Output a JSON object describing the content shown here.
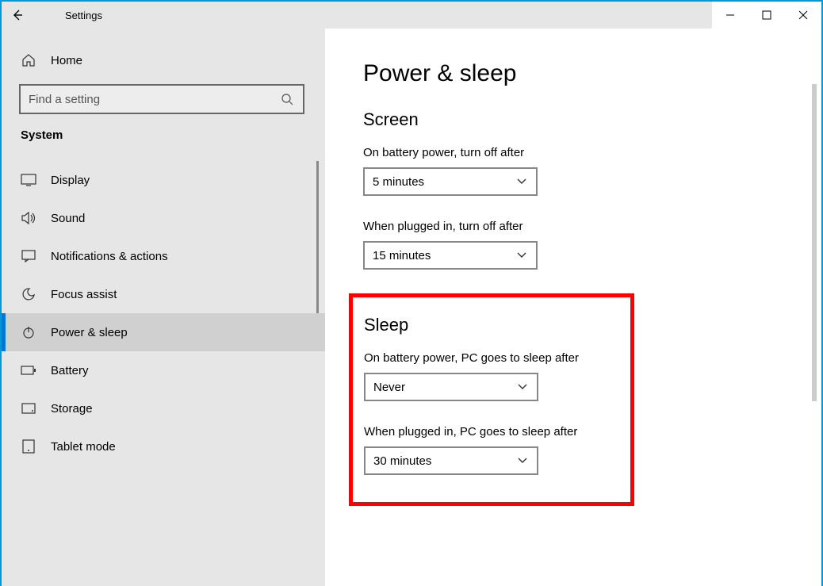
{
  "window": {
    "title": "Settings"
  },
  "sidebar": {
    "home": "Home",
    "search_placeholder": "Find a setting",
    "category": "System",
    "items": [
      {
        "label": "Display"
      },
      {
        "label": "Sound"
      },
      {
        "label": "Notifications & actions"
      },
      {
        "label": "Focus assist"
      },
      {
        "label": "Power & sleep"
      },
      {
        "label": "Battery"
      },
      {
        "label": "Storage"
      },
      {
        "label": "Tablet mode"
      }
    ]
  },
  "main": {
    "title": "Power & sleep",
    "screen": {
      "heading": "Screen",
      "battery_label": "On battery power, turn off after",
      "battery_value": "5 minutes",
      "plugged_label": "When plugged in, turn off after",
      "plugged_value": "15 minutes"
    },
    "sleep": {
      "heading": "Sleep",
      "battery_label": "On battery power, PC goes to sleep after",
      "battery_value": "Never",
      "plugged_label": "When plugged in, PC goes to sleep after",
      "plugged_value": "30 minutes"
    }
  }
}
